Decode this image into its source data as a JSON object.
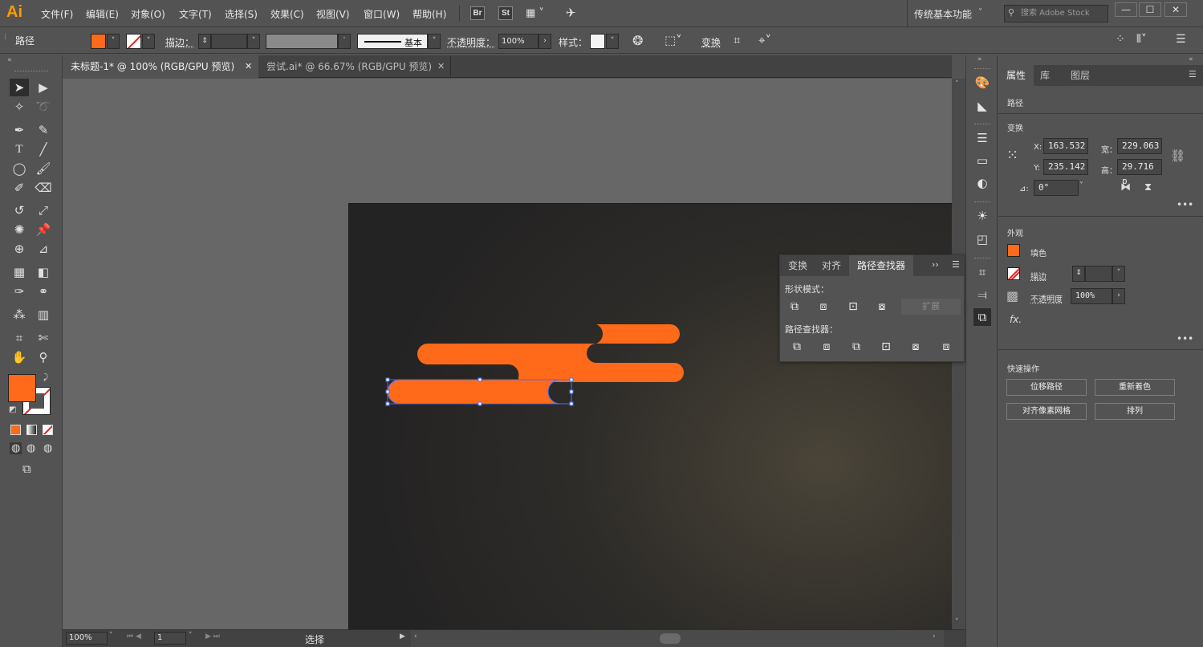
{
  "app": {
    "logo": "Ai"
  },
  "menu": [
    "文件(F)",
    "编辑(E)",
    "对象(O)",
    "文字(T)",
    "选择(S)",
    "效果(C)",
    "视图(V)",
    "窗口(W)",
    "帮助(H)"
  ],
  "appbar": {
    "bridge": "Br",
    "stock": "St",
    "workspace": "传统基本功能",
    "search_placeholder": "搜索 Adobe Stock"
  },
  "window_controls": [
    "—",
    "☐",
    "✕"
  ],
  "control_bar": {
    "object_type": "路径",
    "stroke_label": "描边：",
    "stroke_profile": "基本",
    "opacity_label": "不透明度：",
    "opacity_value": "100%",
    "style_label": "样式：",
    "transform_label": "变换"
  },
  "doc_tabs": [
    {
      "title": "未标题-1* @ 100% (RGB/GPU 预览)",
      "active": true
    },
    {
      "title": "尝试.ai* @ 66.67% (RGB/GPU 预览)",
      "active": false
    }
  ],
  "pathfinder_panel": {
    "tabs": [
      "变换",
      "对齐",
      "路径查找器"
    ],
    "active_tab": "路径查找器",
    "shape_modes_label": "形状模式：",
    "expand_label": "扩展",
    "pathfinders_label": "路径查找器："
  },
  "properties_panel": {
    "tabs": [
      "属性",
      "库",
      "图层"
    ],
    "object_label": "路径",
    "transform_label": "变换",
    "x_label": "X:",
    "x_value": "163.532",
    "y_label": "Y:",
    "y_value": "235.142",
    "w_label": "宽：",
    "w_value": "229.063",
    "h_label": "高：",
    "h_value": "29.716 p",
    "angle_label": "⊿:",
    "angle_value": "0°",
    "appearance_label": "外观",
    "fill_label": "填色",
    "stroke_label": "描边",
    "opacity_label": "不透明度",
    "opacity_value": "100%",
    "fx_label": "fx.",
    "quick_actions_label": "快速操作",
    "buttons": [
      "位移路径",
      "重新着色",
      "对齐像素网格",
      "排列"
    ]
  },
  "status_bar": {
    "zoom": "100%",
    "artboard_num": "1",
    "mode": "选择"
  },
  "colors": {
    "fill": "#ff6a1a",
    "selection": "#4a6cff",
    "accent": "#ff9a00"
  }
}
